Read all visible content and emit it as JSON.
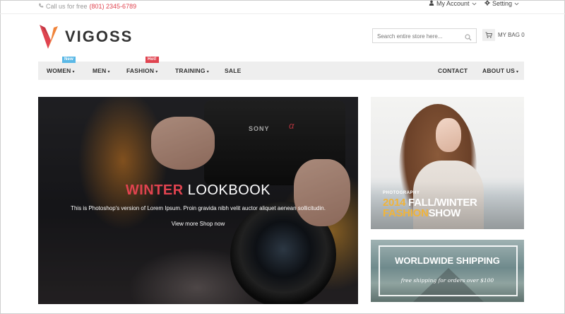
{
  "topbar": {
    "phone_label": "Call us for free",
    "phone_number": "(801) 2345-6789",
    "account_label": "My Account",
    "setting_label": "Setting"
  },
  "header": {
    "logo_text": "VIGOSS",
    "search": {
      "placeholder": "Search entire store here..."
    },
    "bag_label": "MY BAG 0"
  },
  "nav": {
    "items": [
      {
        "label": "WOMEN",
        "caret": "▾",
        "badge": "New"
      },
      {
        "label": "MEN",
        "caret": "▾"
      },
      {
        "label": "FASHION",
        "caret": "▾",
        "badge": "Hot!"
      },
      {
        "label": "TRAINING",
        "caret": "▾"
      },
      {
        "label": "SALE"
      },
      {
        "label": "CONTACT"
      },
      {
        "label": "ABOUT US",
        "caret": "▾"
      }
    ]
  },
  "hero": {
    "title_highlight": "WINTER",
    "title_rest": " LOOKBOOK",
    "description": "This is Photoshop's version of Lorem Ipsum. Proin gravida nibh velit auctor aliquet aenean sollicitudin.",
    "cta": "View more Shop now",
    "camera_brand": "SONY",
    "camera_mark": "α"
  },
  "side_banner_1": {
    "kicker": "PHOTOGRAPHY",
    "line1_year": "2014",
    "line1_rest": " FALL/WINTER",
    "line2_highlight": "FASHION",
    "line2_rest": "SHOW"
  },
  "side_banner_2": {
    "title": "WORLDWIDE SHIPPING",
    "subtitle": "free shipping for orders over $100"
  },
  "colors": {
    "accent_red": "#e0434f",
    "badge_blue": "#5ab8e6",
    "highlight_yellow": "#f0b43a",
    "nav_bg": "#eeeeee"
  }
}
